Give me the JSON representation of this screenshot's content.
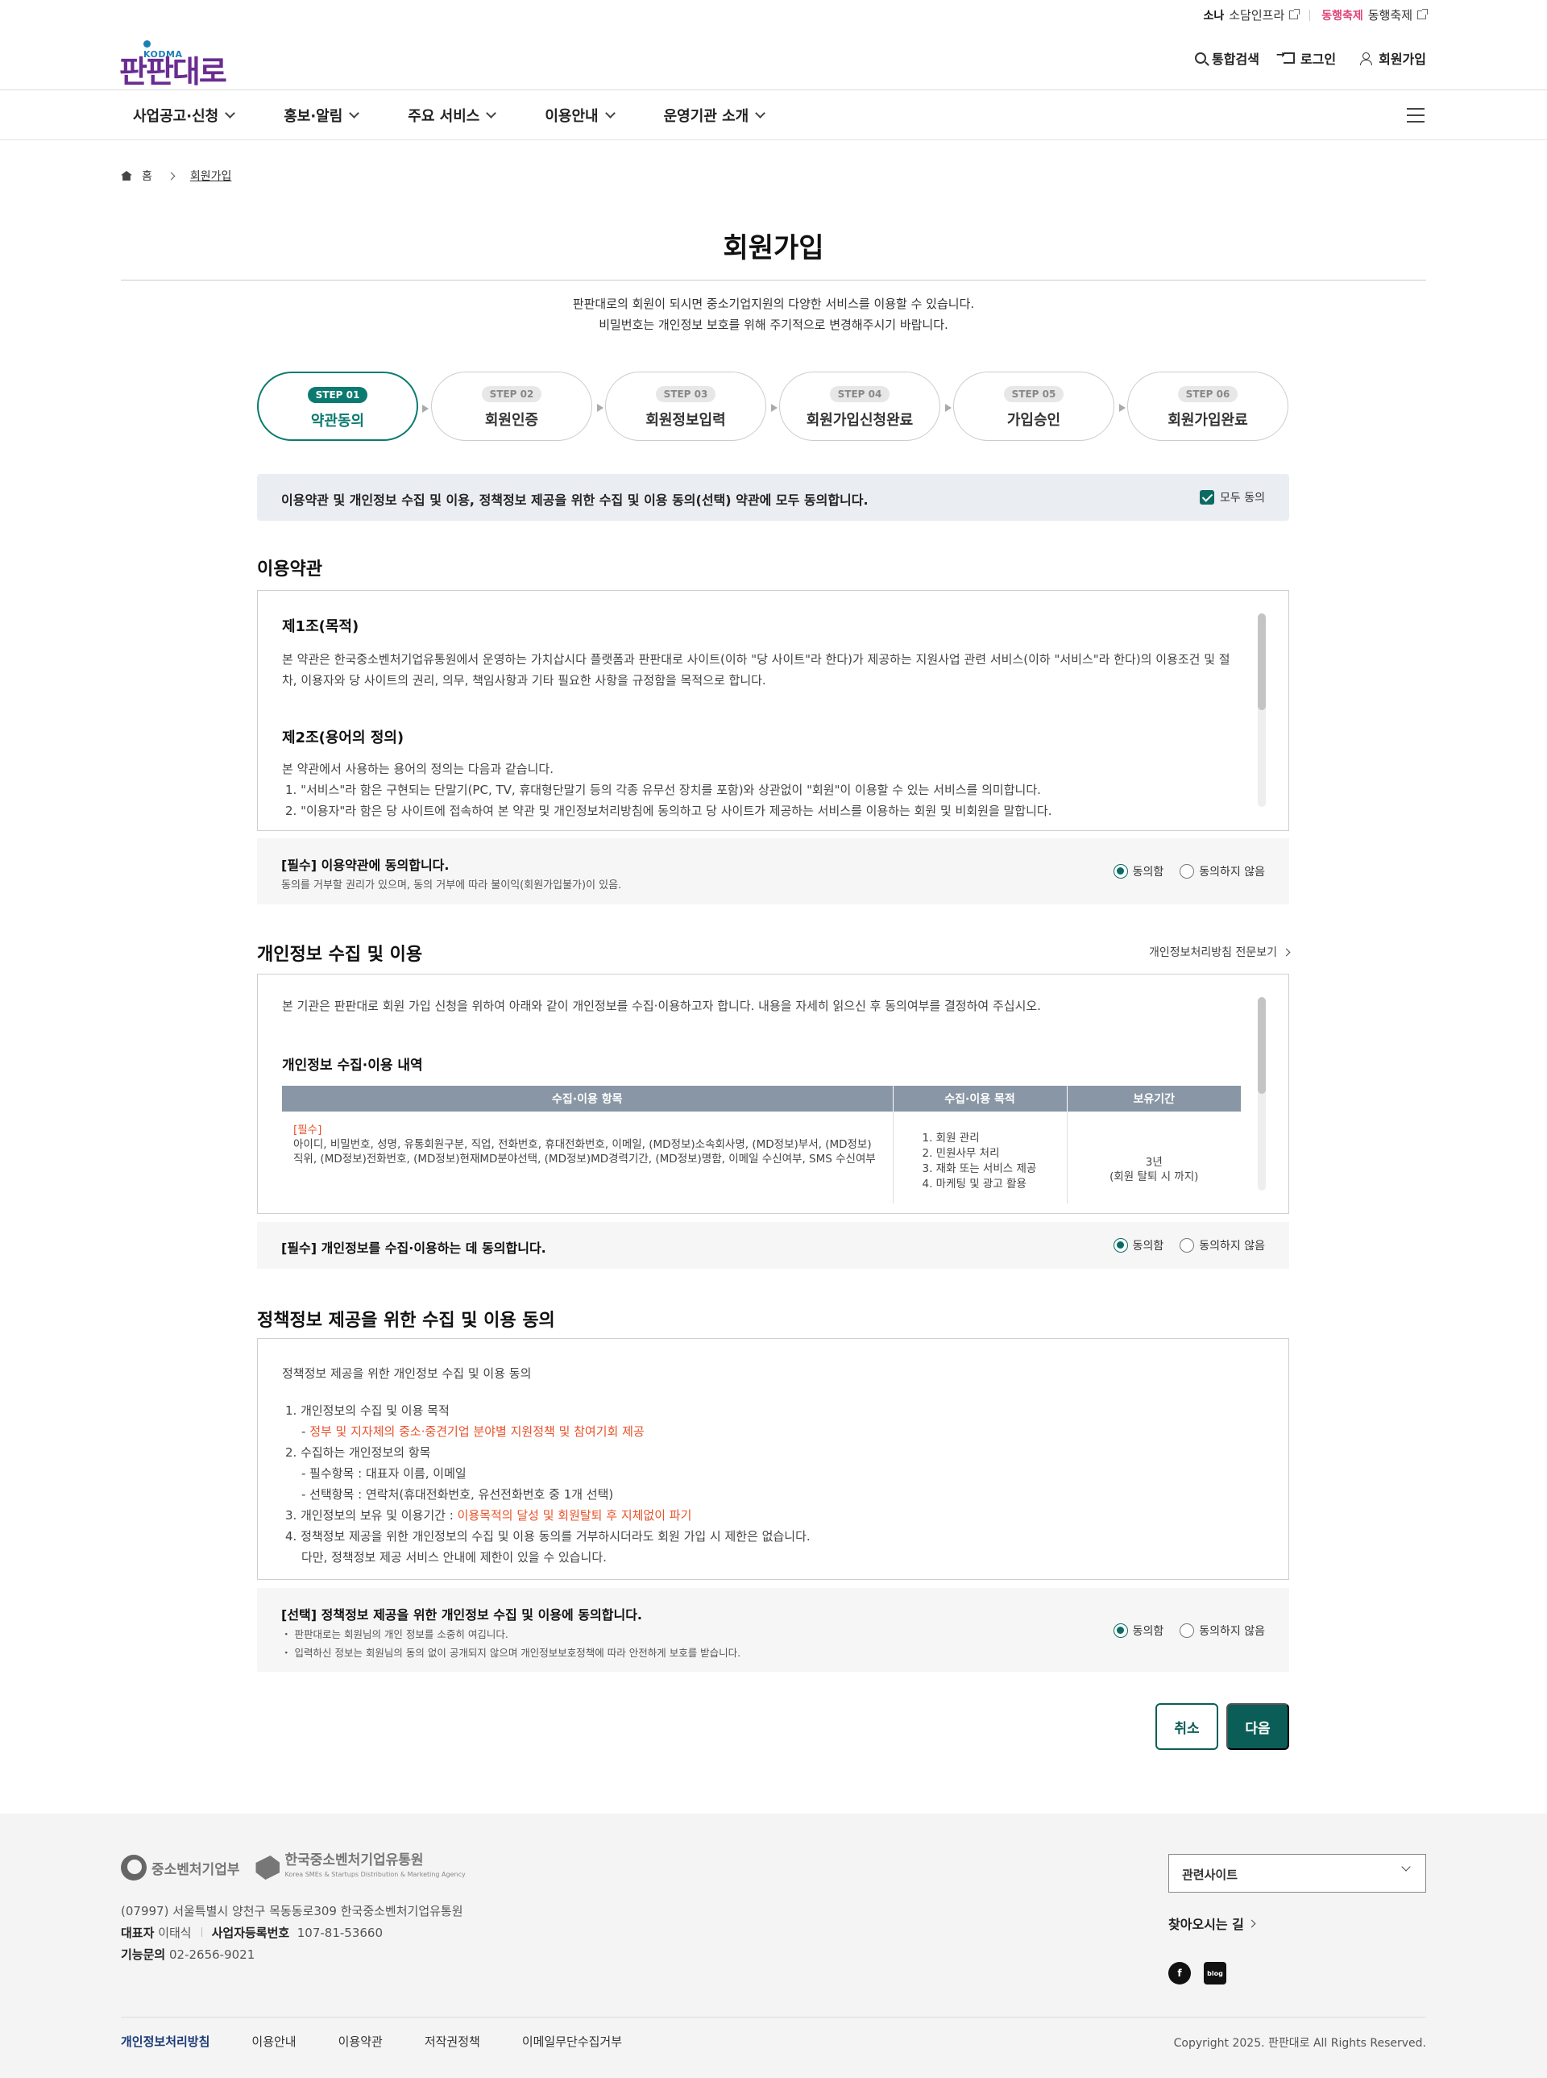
{
  "utility": {
    "link1_logo": "소나",
    "link1": "소담인프라",
    "link2_logo": "동행축제",
    "link2": "동행축제"
  },
  "header": {
    "logo_sub": "KODMA",
    "logo": "판판대로",
    "search": "통합검색",
    "login": "로그인",
    "join": "회원가입"
  },
  "gnb": [
    "사업공고·신청",
    "홍보·알림",
    "주요 서비스",
    "이용안내",
    "운영기관 소개"
  ],
  "breadcrumb": {
    "home": "홈",
    "current": "회원가입"
  },
  "page": {
    "title": "회원가입",
    "intro1": "판판대로의 회원이 되시면 중소기업지원의 다양한 서비스를 이용할 수 있습니다.",
    "intro2": "비밀번호는 개인정보 보호를 위해 주기적으로 변경해주시기 바랍니다."
  },
  "steps": [
    {
      "badge": "STEP 01",
      "label": "약관동의",
      "active": true
    },
    {
      "badge": "STEP 02",
      "label": "회원인증",
      "active": false
    },
    {
      "badge": "STEP 03",
      "label": "회원정보입력",
      "active": false
    },
    {
      "badge": "STEP 04",
      "label": "회원가입신청완료",
      "active": false
    },
    {
      "badge": "STEP 05",
      "label": "가입승인",
      "active": false
    },
    {
      "badge": "STEP 06",
      "label": "회원가입완료",
      "active": false
    }
  ],
  "agree_all": {
    "text": "이용약관 및 개인정보 수집 및 이용, 정책정보 제공을 위한 수집 및 이용 동의(선택) 약관에 모두 동의합니다.",
    "check_label": "모두 동의",
    "checked": true
  },
  "terms": {
    "heading": "이용약관",
    "art1_title": "제1조(목적)",
    "art1_body": "본 약관은 한국중소벤처기업유통원에서 운영하는 가치삽시다 플랫폼과 판판대로 사이트(이하 \"당 사이트\"라 한다)가 제공하는 지원사업 관련 서비스(이하 \"서비스\"라 한다)의 이용조건 및 절차, 이용자와 당 사이트의 권리, 의무, 책임사항과 기타 필요한 사항을 규정함을 목적으로 합니다.",
    "art2_title": "제2조(용어의 정의)",
    "art2_intro": "본 약관에서 사용하는 용어의 정의는 다음과 같습니다.",
    "art2_item1": "1. \"서비스\"라 함은 구현되는 단말기(PC, TV, 휴대형단말기 등의 각종 유무선 장치를 포함)와 상관없이 \"회원\"이 이용할 수 있는 서비스를 의미합니다.",
    "art2_item2": "2. \"이용자\"라 함은 당 사이트에 접속하여 본 약관 및 개인정보처리방침에 동의하고 당 사이트가 제공하는 서비스를 이용하는 회원 및 비회원을 말합니다.",
    "consent_title": "[필수] 이용약관에 동의합니다.",
    "consent_sub": "동의를 거부할 권리가 있으며, 동의 거부에 따라 불이익(회원가입불가)이 있음.",
    "agree": "동의함",
    "disagree": "동의하지 않음",
    "selected": "agree"
  },
  "privacy": {
    "heading": "개인정보 수집 및 이용",
    "full_link": "개인정보처리방침 전문보기",
    "intro": "본 기관은 판판대로 회원 가입 신청을 위하여 아래와 같이 개인정보를 수집·이용하고자 합니다. 내용을 자세히 읽으신 후 동의여부를 결정하여 주십시오.",
    "table_title": "개인정보 수집·이용 내역",
    "columns": [
      "수집·이용 항목",
      "수집·이용 목적",
      "보유기간"
    ],
    "row_req": "[필수]",
    "row_items": "아이디, 비밀번호, 성명, 유통회원구분, 직업, 전화번호, 휴대전화번호, 이메일, (MD정보)소속회사명, (MD정보)부서, (MD정보)직위, (MD정보)전화번호, (MD정보)현재MD분야선택, (MD정보)MD경력기간, (MD정보)명함, 이메일 수신여부, SMS 수신여부",
    "purposes": [
      "1. 회원 관리",
      "2. 민원사무 처리",
      "3. 재화 또는 서비스 제공",
      "4. 마케팅 및 광고 활용"
    ],
    "retention1": "3년",
    "retention2": "(회원 탈퇴 시 까지)",
    "consent_title": "[필수] 개인정보를 수집·이용하는 데 동의합니다.",
    "agree": "동의함",
    "disagree": "동의하지 않음",
    "selected": "agree"
  },
  "policy": {
    "heading": "정책정보 제공을 위한 수집 및 이용 동의",
    "intro": "정책정보 제공을 위한 개인정보 수집 및 이용 동의",
    "l1": "1. 개인정보의 수집 및 이용 목적",
    "l1a_prefix": "- ",
    "l1a": "정부 및 지자체의 중소·중견기업 분야별 지원정책 및 참여기회 제공",
    "l2": "2. 수집하는 개인정보의 항목",
    "l2a": "- 필수항목 : 대표자 이름, 이메일",
    "l2b": "- 선택항목 : 연락처(휴대전화번호, 유선전화번호 중 1개 선택)",
    "l3_prefix": "3. 개인정보의 보유 및 이용기간 : ",
    "l3": "이용목적의 달성 및 회원탈퇴 후 지체없이 파기",
    "l4": "4. 정책정보 제공을 위한 개인정보의 수집 및 이용 동의를 거부하시더라도 회원 가입 시 제한은 없습니다.",
    "l4b": "다만, 정책정보 제공 서비스 안내에 제한이 있을 수 있습니다.",
    "consent_title": "[선택] 정책정보 제공을 위한 개인정보 수집 및 이용에 동의합니다.",
    "bullet1": "・ 판판대로는 회원님의 개인 정보를 소중히 여깁니다.",
    "bullet2": "・ 입력하신 정보는 회원님의 동의 없이 공개되지 않으며 개인정보보호정책에 따라 안전하게 보호를 받습니다.",
    "agree": "동의함",
    "disagree": "동의하지 않음",
    "selected": "agree"
  },
  "buttons": {
    "cancel": "취소",
    "next": "다음"
  },
  "footer": {
    "logo1": "중소벤처기업부",
    "logo2": "한국중소벤처기업유통원",
    "logo2_sub": "Korea SMEs & Startups Distribution & Marketing Agency",
    "address": "(07997) 서울특별시 양천구 목동동로309 한국중소벤처기업유통원",
    "rep_label": "대표자",
    "rep": "이태식",
    "biz_label": "사업자등록번호",
    "biz": "107-81-53660",
    "tel_label": "기능문의",
    "tel": "02-2656-9021",
    "related": "관련사이트",
    "visit": "찾아오시는 길",
    "sns1": "f",
    "sns2": "blog",
    "nav": [
      "개인정보처리방침",
      "이용안내",
      "이용약관",
      "저작권정책",
      "이메일무단수집거부"
    ],
    "copyright": "Copyright 2025. 판판대로 All Rights Reserved."
  },
  "colors": {
    "primary": "#0b5e57",
    "active_step": "#0b7a70",
    "accent_red": "#e8522a",
    "table_head": "#8996a5",
    "logo": "#6a2c91"
  }
}
